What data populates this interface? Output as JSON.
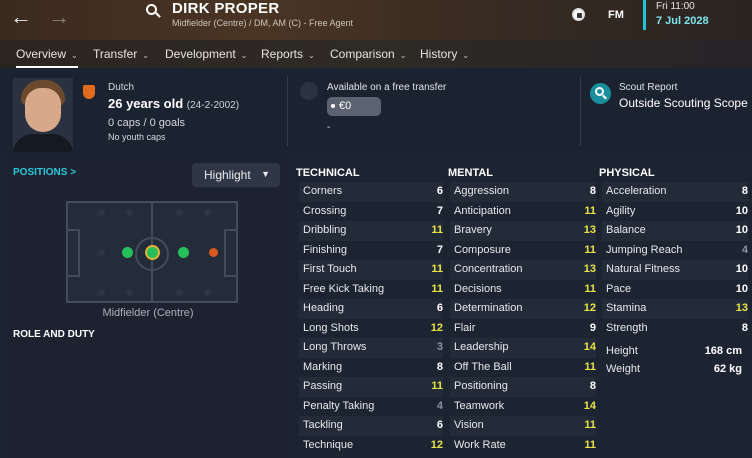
{
  "header": {
    "back_icon": "arrow-left-icon",
    "forward_icon": "arrow-right-icon",
    "player_name": "DIRK PROPER",
    "player_subtitle": "Midfielder (Centre) / DM, AM (C) - Free Agent",
    "logo": "FM",
    "date_line1": "Fri 11:00",
    "date_line2": "7 Jul 2028"
  },
  "tabs": [
    {
      "label": "Overview",
      "active": true
    },
    {
      "label": "Transfer"
    },
    {
      "label": "Development"
    },
    {
      "label": "Reports"
    },
    {
      "label": "Comparison"
    },
    {
      "label": "History"
    }
  ],
  "info": {
    "nationality": "Dutch",
    "age": "26 years old",
    "dob": "(24-2-2002)",
    "caps": "0 caps / 0 goals",
    "youth_caps": "No youth caps",
    "availability": "Available on a free transfer",
    "fee": "€0",
    "fee_sub": "-",
    "scout_title": "Scout Report",
    "scout_value": "Outside Scouting Scope"
  },
  "positions": {
    "label": "POSITIONS >",
    "highlight_button": "Highlight",
    "position_name": "Midfielder (Centre)",
    "role_heading": "ROLE AND DUTY"
  },
  "colors": {
    "accent": "#2bc8da",
    "high_attr": "#e8e347",
    "low_attr": "#8c93a0"
  },
  "attributes": {
    "technical_title": "TECHNICAL",
    "mental_title": "MENTAL",
    "physical_title": "PHYSICAL",
    "technical": [
      {
        "name": "Corners",
        "value": "6"
      },
      {
        "name": "Crossing",
        "value": "7"
      },
      {
        "name": "Dribbling",
        "value": "11"
      },
      {
        "name": "Finishing",
        "value": "7"
      },
      {
        "name": "First Touch",
        "value": "11"
      },
      {
        "name": "Free Kick Taking",
        "value": "11"
      },
      {
        "name": "Heading",
        "value": "6"
      },
      {
        "name": "Long Shots",
        "value": "12"
      },
      {
        "name": "Long Throws",
        "value": "3"
      },
      {
        "name": "Marking",
        "value": "8"
      },
      {
        "name": "Passing",
        "value": "11"
      },
      {
        "name": "Penalty Taking",
        "value": "4"
      },
      {
        "name": "Tackling",
        "value": "6"
      },
      {
        "name": "Technique",
        "value": "12"
      }
    ],
    "mental": [
      {
        "name": "Aggression",
        "value": "8"
      },
      {
        "name": "Anticipation",
        "value": "11"
      },
      {
        "name": "Bravery",
        "value": "13"
      },
      {
        "name": "Composure",
        "value": "11"
      },
      {
        "name": "Concentration",
        "value": "13"
      },
      {
        "name": "Decisions",
        "value": "11"
      },
      {
        "name": "Determination",
        "value": "12"
      },
      {
        "name": "Flair",
        "value": "9"
      },
      {
        "name": "Leadership",
        "value": "14"
      },
      {
        "name": "Off The Ball",
        "value": "11"
      },
      {
        "name": "Positioning",
        "value": "8"
      },
      {
        "name": "Teamwork",
        "value": "14"
      },
      {
        "name": "Vision",
        "value": "11"
      },
      {
        "name": "Work Rate",
        "value": "11"
      }
    ],
    "physical": [
      {
        "name": "Acceleration",
        "value": "8"
      },
      {
        "name": "Agility",
        "value": "10"
      },
      {
        "name": "Balance",
        "value": "10"
      },
      {
        "name": "Jumping Reach",
        "value": "4"
      },
      {
        "name": "Natural Fitness",
        "value": "10"
      },
      {
        "name": "Pace",
        "value": "10"
      },
      {
        "name": "Stamina",
        "value": "13"
      },
      {
        "name": "Strength",
        "value": "8"
      }
    ],
    "height_label": "Height",
    "height_value": "168 cm",
    "weight_label": "Weight",
    "weight_value": "62 kg"
  }
}
